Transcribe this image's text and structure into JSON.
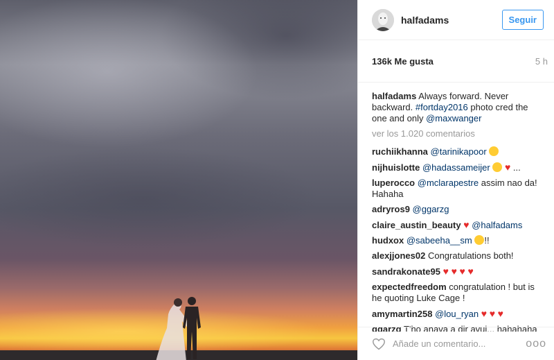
{
  "post": {
    "username": "halfadams",
    "follow_label": "Seguir",
    "likes": "136k Me gusta",
    "time": "5 h",
    "caption": {
      "user": "halfadams",
      "text1": "Always forward. Never backward.",
      "hashtag": "#fortday2016",
      "text2": "photo cred the one and only",
      "mention": "@maxwanger"
    },
    "view_all": "ver los 1.020 comentarios",
    "comments": [
      {
        "user": "ruchiikhanna",
        "mention": "@tarinikapoor"
      },
      {
        "user": "nijhuislotte",
        "mention": "@hadassameijer",
        "tail": "..."
      },
      {
        "user": "luperocco",
        "mention": "@mclarapestre",
        "text": "assim nao da! Hahaha"
      },
      {
        "user": "adryros9",
        "mention": "@ggarzg"
      },
      {
        "user": "claire_austin_beauty",
        "mention": "@halfadams"
      },
      {
        "user": "hudxox",
        "mention": "@sabeeha__sm",
        "tail": "!!"
      },
      {
        "user": "alexjjones02",
        "text": "Congratulations both!"
      },
      {
        "user": "sandrakonate95"
      },
      {
        "user": "expectedfreedom",
        "text": "congratulation ! but is he quoting Luke Cage !"
      },
      {
        "user": "amymartin258",
        "mention": "@lou_ryan"
      },
      {
        "user": "ggarzg",
        "text": "T'ho anava a dir avui... hahahaha"
      }
    ],
    "add_comment_placeholder": "Añade un comentario...",
    "more_options": "ooo"
  },
  "icons": {
    "like": "heart-outline-icon",
    "options": "ellipsis-icon",
    "avatar": "avatar"
  },
  "colors": {
    "follow_blue": "#3897f0",
    "link_blue": "#003569",
    "heart_red": "#e52b2b"
  }
}
